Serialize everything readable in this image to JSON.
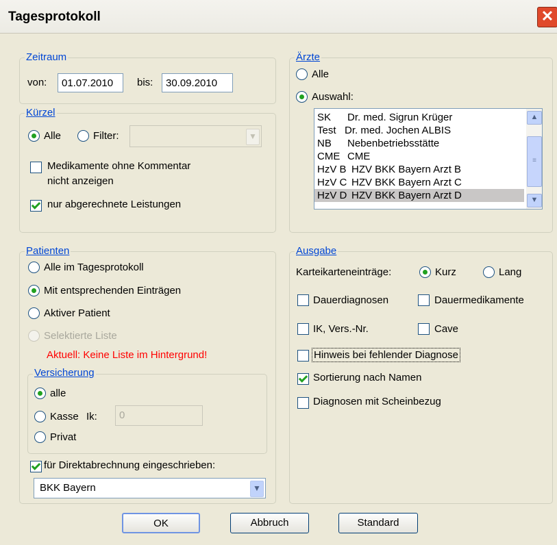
{
  "window": {
    "title": "Tagesprotokoll",
    "close_icon": "close-icon"
  },
  "zeitraum": {
    "legend": "Zeitraum",
    "von_label": "von:",
    "von_value": "01.07.2010",
    "bis_label": "bis:",
    "bis_value": "30.09.2010"
  },
  "kuerzel": {
    "legend": "Kürzel",
    "alle_label": "Alle",
    "alle_selected": true,
    "filter_label": "Filter:",
    "filter_value": "",
    "medikamente_line1": "Medikamente ohne Kommentar",
    "medikamente_line2": "nicht anzeigen",
    "medikamente_checked": false,
    "abgerechnet_label": "nur abgerechnete Leistungen",
    "abgerechnet_checked": true
  },
  "aerzte": {
    "legend": "Ärzte",
    "alle_label": "Alle",
    "auswahl_label": "Auswahl:",
    "selected_option": "Auswahl",
    "list": [
      {
        "code": "SK",
        "name": "Dr. med. Sigrun Krüger"
      },
      {
        "code": "Test",
        "name": "Dr. med. Jochen ALBIS"
      },
      {
        "code": "NB",
        "name": "Nebenbetriebsstätte"
      },
      {
        "code": "CME",
        "name": "CME"
      },
      {
        "code": "HzV B",
        "name": "HZV BKK Bayern Arzt B"
      },
      {
        "code": "HzV C",
        "name": "HZV BKK Bayern Arzt C"
      },
      {
        "code": "HzV D",
        "name": "HZV BKK Bayern Arzt D",
        "selected": true
      }
    ]
  },
  "patienten": {
    "legend": "Patienten",
    "options": [
      "Alle im Tagesprotokoll",
      "Mit entsprechenden Einträgen",
      "Aktiver Patient",
      "Selektierte Liste"
    ],
    "selected_index": 1,
    "warning": "Aktuell: Keine Liste im Hintergrund!",
    "versicherung": {
      "legend": "Versicherung",
      "alle_label": "alle",
      "kasse_label": "Kasse",
      "ik_label": "Ik:",
      "ik_value": "0",
      "privat_label": "Privat",
      "selected": "alle"
    },
    "direkt_label": "für Direktabrechnung eingeschrieben:",
    "direkt_checked": true,
    "kasse_select": "BKK Bayern"
  },
  "ausgabe": {
    "legend": "Ausgabe",
    "kartei_label": "Karteikarteneinträge:",
    "kurz_label": "Kurz",
    "lang_label": "Lang",
    "kartei_selected": "Kurz",
    "dauerdiagnosen_label": "Dauerdiagnosen",
    "dauermedikamente_label": "Dauermedikamente",
    "ik_vers_label": "IK, Vers.-Nr.",
    "cave_label": "Cave",
    "hinweis_label": "Hinweis bei fehlender Diagnose",
    "sortierung_label": "Sortierung nach Namen",
    "sortierung_checked": true,
    "diagnosen_label": "Diagnosen mit Scheinbezug"
  },
  "buttons": {
    "ok": "OK",
    "abbruch": "Abbruch",
    "standard": "Standard"
  }
}
